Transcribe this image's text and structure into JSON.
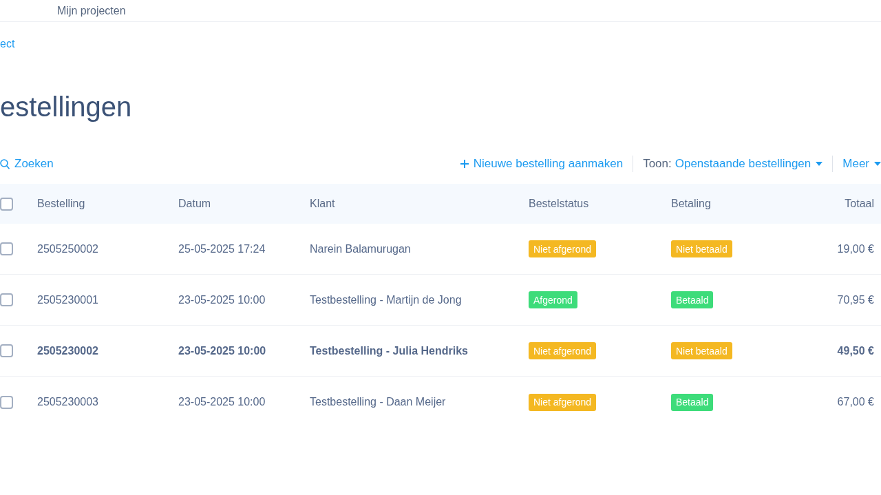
{
  "header": {
    "breadcrumb": "Mijn projecten"
  },
  "back_link": "ect",
  "title": "estellingen",
  "toolbar": {
    "search": "Zoeken",
    "new_order": "Nieuwe bestelling aanmaken",
    "filter_label": "Toon:",
    "filter_value": "Openstaande bestellingen",
    "more": "Meer"
  },
  "table": {
    "select_all_checked": false,
    "columns": [
      "Bestelling",
      "Datum",
      "Klant",
      "Bestelstatus",
      "Betaling",
      "Totaal"
    ],
    "rows": [
      {
        "checked": false,
        "emphasized": false,
        "order": "2505250002",
        "date": "25-05-2025 17:24",
        "customer": "Narein Balamurugan",
        "order_status": {
          "text": "Niet afgerond",
          "color": "#f4b822"
        },
        "payment": {
          "text": "Niet betaald",
          "color": "#f4b822"
        },
        "total": "19,00 €"
      },
      {
        "checked": false,
        "emphasized": false,
        "order": "2505230001",
        "date": "23-05-2025 10:00",
        "customer": "Testbestelling - Martijn de Jong",
        "order_status": {
          "text": "Afgerond",
          "color": "#3ddc7a"
        },
        "payment": {
          "text": "Betaald",
          "color": "#3ddc7a"
        },
        "total": "70,95 €"
      },
      {
        "checked": false,
        "emphasized": true,
        "order": "2505230002",
        "date": "23-05-2025 10:00",
        "customer": "Testbestelling - Julia Hendriks",
        "order_status": {
          "text": "Niet afgerond",
          "color": "#f4b822"
        },
        "payment": {
          "text": "Niet betaald",
          "color": "#f4b822"
        },
        "total": "49,50 €"
      },
      {
        "checked": false,
        "emphasized": false,
        "order": "2505230003",
        "date": "23-05-2025 10:00",
        "customer": "Testbestelling - Daan Meijer",
        "order_status": {
          "text": "Niet afgerond",
          "color": "#f4b822"
        },
        "payment": {
          "text": "Betaald",
          "color": "#3ddc7a"
        },
        "total": "67,00 €"
      }
    ]
  }
}
